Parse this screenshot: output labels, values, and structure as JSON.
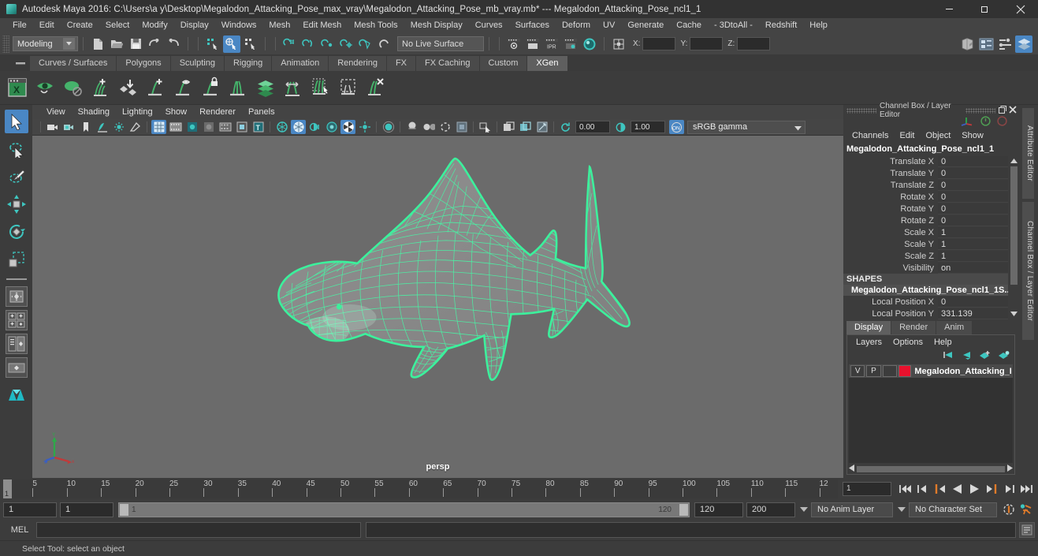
{
  "window": {
    "title": "Autodesk Maya 2016: C:\\Users\\a y\\Desktop\\Megalodon_Attacking_Pose_max_vray\\Megalodon_Attacking_Pose_mb_vray.mb*  ---  Megalodon_Attacking_Pose_ncl1_1",
    "icon": "maya-logo-icon",
    "minimize": "minimize-button",
    "maximize": "restore-button",
    "close": "close-button"
  },
  "menubar": {
    "items": [
      "File",
      "Edit",
      "Create",
      "Select",
      "Modify",
      "Display",
      "Windows",
      "Mesh",
      "Edit Mesh",
      "Mesh Tools",
      "Mesh Display",
      "Curves",
      "Surfaces",
      "Deform",
      "UV",
      "Generate",
      "Cache",
      "- 3DtoAll -",
      "Redshift",
      "Help"
    ]
  },
  "statusline": {
    "menu_set": "Modeling",
    "live_surface": "No Live Surface",
    "coord_labels": [
      "X:",
      "Y:",
      "Z:"
    ],
    "coord_values": [
      "",
      "",
      ""
    ]
  },
  "shelf": {
    "tabs": [
      "Curves / Surfaces",
      "Polygons",
      "Sculpting",
      "Rigging",
      "Animation",
      "Rendering",
      "FX",
      "FX Caching",
      "Custom",
      "XGen"
    ],
    "active_tab": "XGen",
    "icons": [
      "xgen-editor-icon",
      "xgen-preview-icon",
      "xgen-description-icon",
      "add-guide-icon",
      "place-guide-icon",
      "grow-guide-icon",
      "guide-visibility-icon",
      "lock-guide-icon",
      "comb-guide-icon",
      "layers-icon",
      "length-tool-icon",
      "select-guide-icon",
      "region-tool-icon",
      "delete-guide-icon"
    ]
  },
  "toolbox": {
    "tools": [
      "select-tool",
      "lasso-select-tool",
      "paint-select-tool",
      "move-tool",
      "rotate-tool",
      "scale-tool"
    ],
    "selected_tool": "select-tool",
    "layouts": [
      "single-view-layout",
      "four-view-layout",
      "outliner-persp-layout",
      "persp-graph-layout",
      "hypershade-layout"
    ]
  },
  "viewport": {
    "menus": [
      "View",
      "Shading",
      "Lighting",
      "Show",
      "Renderer",
      "Panels"
    ],
    "camera_label": "persp",
    "exposure": "0.00",
    "gamma": "1.00",
    "color_space": "sRGB gamma",
    "background_color": "#6b6b6b",
    "mesh_wire_color": "#3cf09c",
    "model": "megalodon-shark-wireframe",
    "toolbar_icons": [
      "camera-icon",
      "camera-attributes-icon",
      "bookmark-icon",
      "image-plane-icon",
      "two-sided-lighting-icon",
      "lighting-icon",
      "wireframe-icon",
      "smooth-shade-all-icon",
      "shaded-flat-icon",
      "shaded-texture-icon",
      "wireframe-on-shaded-icon",
      "texture-border-icon",
      "xray-icon",
      "xray-joints-icon",
      "default-lighting-icon",
      "all-lights-icon",
      "shadows-icon",
      "ao-icon",
      "motion-blur-icon",
      "multisample-icon",
      "isolate-select-icon",
      "grid-icon",
      "film-gate-icon",
      "resolution-gate-icon",
      "gate-mask-icon",
      "exposure-icon",
      "gamma-icon",
      "color-management-icon"
    ]
  },
  "channelbox": {
    "panel_title": "Channel Box / Layer Editor",
    "menus": [
      "Channels",
      "Edit",
      "Object",
      "Show"
    ],
    "object_name": "Megalodon_Attacking_Pose_ncl1_1",
    "transform_attrs": [
      {
        "label": "Translate X",
        "value": "0"
      },
      {
        "label": "Translate Y",
        "value": "0"
      },
      {
        "label": "Translate Z",
        "value": "0"
      },
      {
        "label": "Rotate X",
        "value": "0"
      },
      {
        "label": "Rotate Y",
        "value": "0"
      },
      {
        "label": "Rotate Z",
        "value": "0"
      },
      {
        "label": "Scale X",
        "value": "1"
      },
      {
        "label": "Scale Y",
        "value": "1"
      },
      {
        "label": "Scale Z",
        "value": "1"
      },
      {
        "label": "Visibility",
        "value": "on"
      }
    ],
    "shapes_header": "SHAPES",
    "shape_name": "Megalodon_Attacking_Pose_ncl1_1S...",
    "shape_attrs": [
      {
        "label": "Local Position X",
        "value": "0"
      },
      {
        "label": "Local Position Y",
        "value": "331.139"
      }
    ]
  },
  "layer_editor": {
    "tabs": [
      "Display",
      "Render",
      "Anim"
    ],
    "active_tab": "Display",
    "menus": [
      "Layers",
      "Options",
      "Help"
    ],
    "toolbar_icons": [
      "layer-first-icon",
      "layer-prev-icon",
      "layer-new-icon",
      "layer-new-selected-icon"
    ],
    "layers": [
      {
        "visibility": "V",
        "playback": "P",
        "shading": "",
        "color": "#e8112d",
        "name": "Megalodon_Attacking_P"
      }
    ]
  },
  "side_tabs": {
    "attribute_editor": "Attribute Editor",
    "channel_box": "Channel Box / Layer Editor"
  },
  "timeline": {
    "tick_labels": [
      "5",
      "10",
      "15",
      "20",
      "25",
      "30",
      "35",
      "40",
      "45",
      "50",
      "55",
      "60",
      "65",
      "70",
      "75",
      "80",
      "85",
      "90",
      "95",
      "100",
      "105",
      "110",
      "115",
      "12"
    ],
    "current_frame": "1",
    "current_frame_field": "1",
    "playback_buttons": [
      "go-to-start-icon",
      "step-back-keyframe-icon",
      "step-back-frame-icon",
      "play-backwards-icon",
      "play-forwards-icon",
      "step-forward-frame-icon",
      "step-forward-keyframe-icon",
      "go-to-end-icon"
    ]
  },
  "range_slider": {
    "anim_start": "1",
    "range_start": "1",
    "range_bar_start": "1",
    "range_bar_end": "120",
    "range_end": "120",
    "anim_end": "200",
    "anim_layer": "No Anim Layer",
    "character_set": "No Character Set",
    "auto_key_icon": "auto-keyframe-icon",
    "anim_prefs_icon": "animation-preferences-icon"
  },
  "command_line": {
    "language": "MEL",
    "input_value": "",
    "output_value": "",
    "script_editor_icon": "script-editor-icon"
  },
  "help_line": {
    "text": "Select Tool: select an object"
  },
  "colors": {
    "accent_blue": "#4a87c4",
    "teal": "#3ec6c0",
    "xgen_green": "#45b36b",
    "layer_red": "#e8112d",
    "orange": "#e07b2a"
  }
}
